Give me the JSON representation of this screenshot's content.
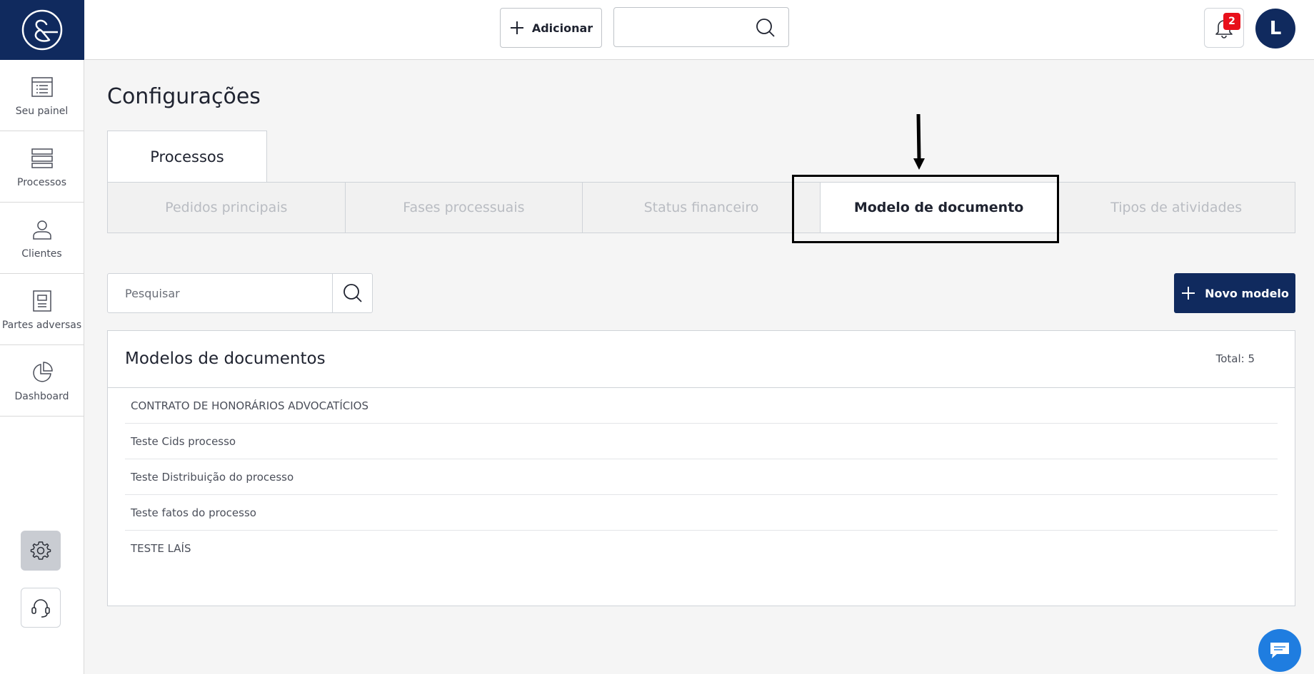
{
  "sidebar": {
    "items": [
      {
        "label": "Seu painel",
        "icon": "dashboard-panel-icon"
      },
      {
        "label": "Processos",
        "icon": "stack-icon"
      },
      {
        "label": "Clientes",
        "icon": "user-icon"
      },
      {
        "label": "Partes adversas",
        "icon": "document-icon"
      },
      {
        "label": "Dashboard",
        "icon": "pie-chart-icon"
      }
    ]
  },
  "topbar": {
    "add_label": "Adicionar",
    "search_value": "",
    "notifications_count": "2",
    "avatar_initial": "L"
  },
  "page": {
    "title": "Configurações",
    "main_tab": "Processos",
    "subtabs": [
      "Pedidos principais",
      "Fases processuais",
      "Status financeiro",
      "Modelo de documento",
      "Tipos de atividades"
    ],
    "active_subtab": "Modelo de documento"
  },
  "search": {
    "placeholder": "Pesquisar",
    "value": ""
  },
  "new_button": {
    "label": "Novo modelo"
  },
  "panel": {
    "title": "Modelos de documentos",
    "total": "Total: 5",
    "items": [
      "CONTRATO DE HONORÁRIOS ADVOCATÍCIOS",
      "Teste Cids processo",
      "Teste Distribuição do processo",
      "Teste fatos do processo",
      "TESTE LAÍS"
    ]
  },
  "colors": {
    "brand": "#102a5e",
    "badge": "#e8101b",
    "chat": "#1f7de0"
  }
}
